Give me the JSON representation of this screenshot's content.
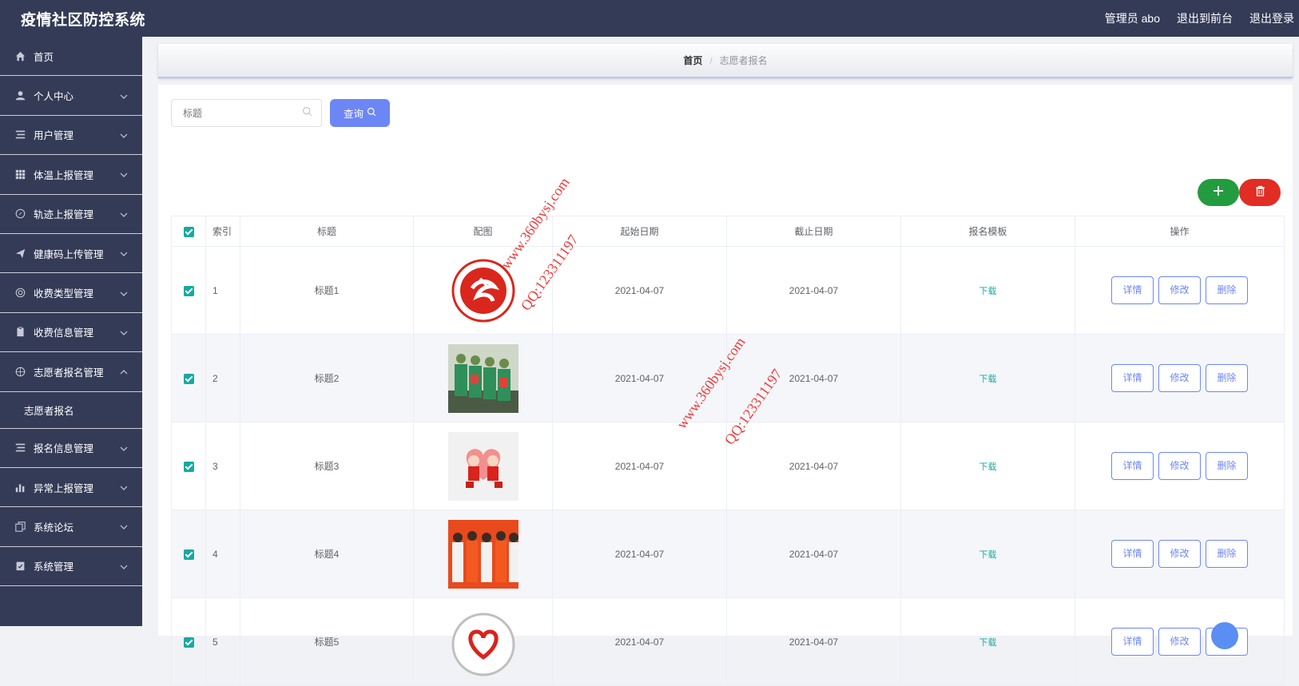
{
  "header": {
    "title": "疫情社区防控系统",
    "admin": "管理员 abo",
    "to_front": "退出到前台",
    "logout": "退出登录"
  },
  "sidebar": {
    "items": [
      {
        "label": "首页",
        "icon": "home-icon",
        "expandable": false
      },
      {
        "label": "个人中心",
        "icon": "user-icon",
        "expandable": true
      },
      {
        "label": "用户管理",
        "icon": "list-icon",
        "expandable": true
      },
      {
        "label": "体温上报管理",
        "icon": "grid-icon",
        "expandable": true
      },
      {
        "label": "轨迹上报管理",
        "icon": "compass-icon",
        "expandable": true
      },
      {
        "label": "健康码上传管理",
        "icon": "send-icon",
        "expandable": true
      },
      {
        "label": "收费类型管理",
        "icon": "lifebuoy-icon",
        "expandable": true
      },
      {
        "label": "收费信息管理",
        "icon": "clipboard-icon",
        "expandable": true
      },
      {
        "label": "志愿者报名管理",
        "icon": "target-icon",
        "expandable": true,
        "open": true
      },
      {
        "label": "志愿者报名",
        "sub": true
      },
      {
        "label": "报名信息管理",
        "icon": "list-icon",
        "expandable": true
      },
      {
        "label": "异常上报管理",
        "icon": "bar-chart-icon",
        "expandable": true
      },
      {
        "label": "系统论坛",
        "icon": "copy-icon",
        "expandable": true
      },
      {
        "label": "系统管理",
        "icon": "clipboard-check-icon",
        "expandable": true
      }
    ]
  },
  "breadcrumb": {
    "home": "首页",
    "sep": "/",
    "current": "志愿者报名"
  },
  "search": {
    "placeholder": "标题",
    "button": "查询"
  },
  "table": {
    "headers": [
      "索引",
      "标题",
      "配图",
      "起始日期",
      "截止日期",
      "报名模板",
      "操作"
    ],
    "rows": [
      {
        "index": "1",
        "title": "标题1",
        "image": "volunteer-logo",
        "start": "2021-04-07",
        "end": "2021-04-07",
        "template": "下载"
      },
      {
        "index": "2",
        "title": "标题2",
        "image": "volunteers-photo",
        "start": "2021-04-07",
        "end": "2021-04-07",
        "template": "下载"
      },
      {
        "index": "3",
        "title": "标题3",
        "image": "cartoon-couple",
        "start": "2021-04-07",
        "end": "2021-04-07",
        "template": "下载"
      },
      {
        "index": "4",
        "title": "标题4",
        "image": "red-volunteers-photo",
        "start": "2021-04-07",
        "end": "2021-04-07",
        "template": "下载"
      },
      {
        "index": "5",
        "title": "标题5",
        "image": "heart-logo",
        "start": "2021-04-07",
        "end": "2021-04-07",
        "template": "下载"
      }
    ],
    "actions": {
      "detail": "详情",
      "edit": "修改",
      "delete": "删除"
    }
  },
  "watermark": {
    "site": "www.360bysj.com",
    "qq": "QQ:123311197"
  },
  "colors": {
    "sidebar_bg": "#343b57",
    "primary": "#6d86f6",
    "success": "#239b3f",
    "danger": "#e12d24",
    "teal": "#17a9a0",
    "watermark": "#ee3b3b"
  }
}
